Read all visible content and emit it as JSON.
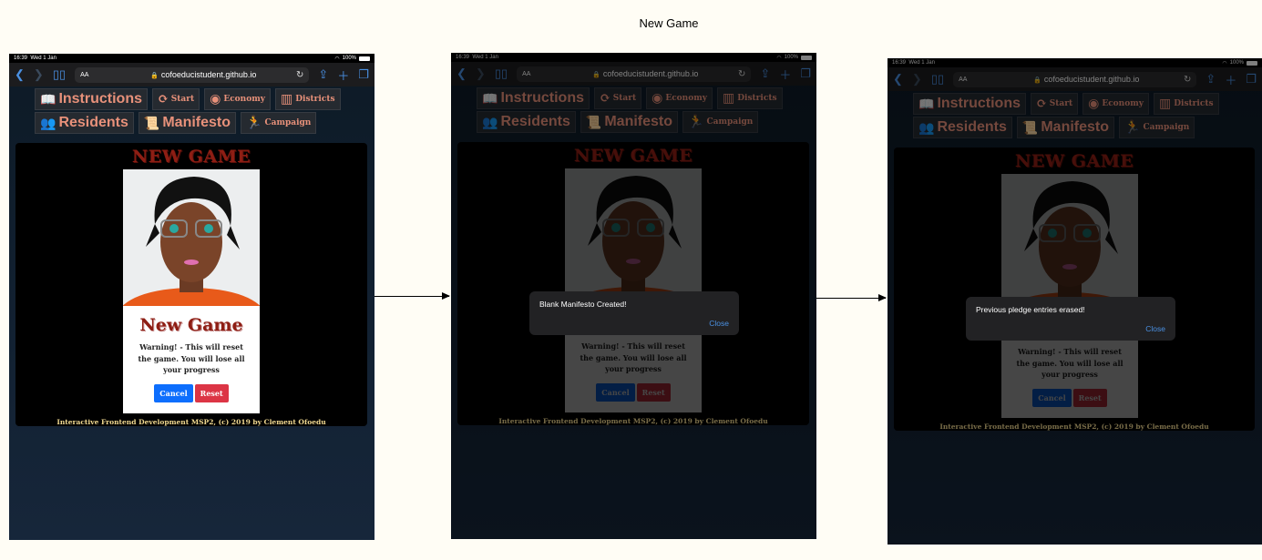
{
  "page_title": "New Game",
  "status_bar": {
    "time": "16:39",
    "date": "Wed 1 Jan",
    "battery": "100%"
  },
  "browser": {
    "aa": "AA",
    "url": "cofoeducistudent.github.io"
  },
  "nav": {
    "instructions": "Instructions",
    "start": "Start",
    "economy": "Economy",
    "districts": "Districts",
    "residents": "Residents",
    "manifesto": "Manifesto",
    "campaign": "Campaign"
  },
  "game": {
    "heading": "NEW GAME",
    "modal_title": "New Game",
    "warning": "Warning! - This will reset the game. You will lose all your progress",
    "cancel": "Cancel",
    "reset": "Reset",
    "footer": "Interactive Frontend Development MSP2, (c) 2019 by Clement Ofoedu"
  },
  "alerts": {
    "first": {
      "message": "Blank Manifesto Created!",
      "close": "Close"
    },
    "second": {
      "message": "Previous pledge entries erased!",
      "close": "Close"
    }
  },
  "colors": {
    "heading_red": "#8e1e14",
    "nav_text": "#e8917a",
    "cancel_blue": "#0d6efd",
    "reset_red": "#dc3545",
    "link_blue": "#4a90e2"
  }
}
